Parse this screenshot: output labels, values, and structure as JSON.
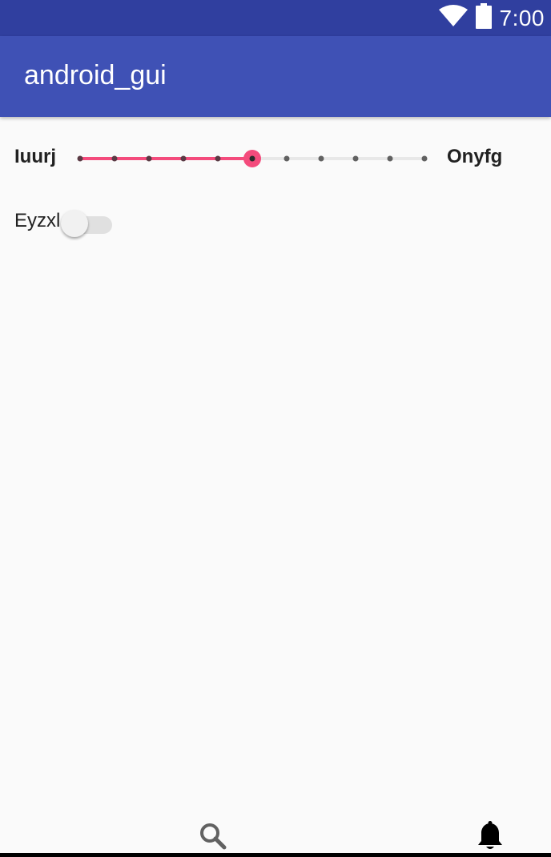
{
  "status_bar": {
    "time": "7:00",
    "icons": [
      "wifi-icon",
      "battery-icon"
    ]
  },
  "app_bar": {
    "title": "android_gui"
  },
  "slider": {
    "label_left": "Iuurj",
    "label_right": "Onyfg",
    "steps": 10,
    "value_step": 5,
    "accent_color": "#f44b7c"
  },
  "switch": {
    "label": "Eyzxl",
    "checked": false
  },
  "bottom_bar": {
    "icons": [
      "search-icon",
      "bell-icon"
    ]
  },
  "colors": {
    "status_bar": "#303f9f",
    "app_bar": "#3f51b5",
    "background": "#fafafa",
    "slider_active": "#f44b7c",
    "slider_inactive": "#e8e8e8",
    "tick": "#616161"
  }
}
